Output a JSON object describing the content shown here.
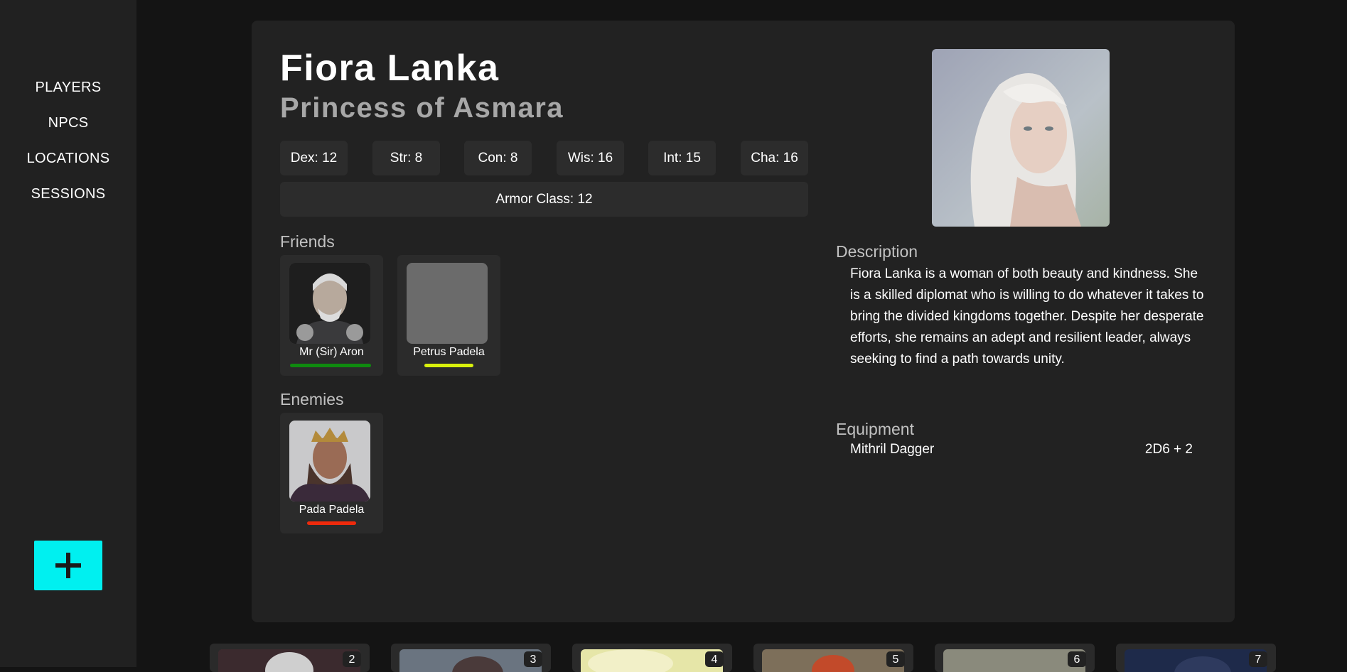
{
  "sidebar": {
    "items": [
      {
        "label": "PLAYERS"
      },
      {
        "label": "NPCS"
      },
      {
        "label": "LOCATIONS"
      },
      {
        "label": "SESSIONS"
      }
    ],
    "add_icon": "plus-icon",
    "accent_color": "#00f0f0"
  },
  "character": {
    "name": "Fiora Lanka",
    "title": "Princess of Asmara",
    "stats": [
      {
        "label": "Dex: 12"
      },
      {
        "label": "Str: 8"
      },
      {
        "label": "Con: 8"
      },
      {
        "label": "Wis: 16"
      },
      {
        "label": "Int: 15"
      },
      {
        "label": "Cha: 16"
      }
    ],
    "armor_class": "Armor Class: 12",
    "friends_heading": "Friends",
    "friends": [
      {
        "name": "Mr (Sir) Aron",
        "relation_color": "#0f8a0f"
      },
      {
        "name": "Petrus Padela",
        "relation_color": "#d8f00c"
      }
    ],
    "enemies_heading": "Enemies",
    "enemies": [
      {
        "name": "Pada Padela",
        "relation_color": "#ee2a0c"
      }
    ],
    "description_heading": "Description",
    "description": "Fiora Lanka is a woman of both beauty and kindness. She is a skilled diplomat who is willing to do whatever it takes to bring the divided kingdoms together. Despite her desperate efforts, she remains an adept and resilient leader, always seeking to find a path towards unity.",
    "equipment_heading": "Equipment",
    "equipment": [
      {
        "name": "Mithril Dagger",
        "damage": "2D6 + 2"
      }
    ]
  },
  "strip": [
    {
      "number": "2"
    },
    {
      "number": "3"
    },
    {
      "number": "4"
    },
    {
      "number": "5"
    },
    {
      "number": "6"
    },
    {
      "number": "7"
    }
  ]
}
